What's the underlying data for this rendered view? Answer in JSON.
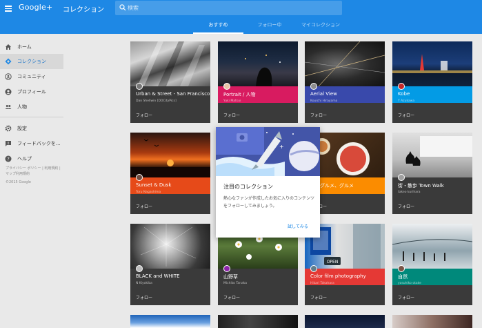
{
  "appbar": {
    "logo": "Google+",
    "title": "コレクション",
    "search_placeholder": "検索",
    "tabs": [
      {
        "label": "おすすめ",
        "active": true
      },
      {
        "label": "フォロー中",
        "active": false
      },
      {
        "label": "マイコレクション",
        "active": false
      }
    ],
    "color": "#1e88e5"
  },
  "sidebar": {
    "items": [
      {
        "label": "ホーム",
        "icon": "home-icon"
      },
      {
        "label": "コレクション",
        "icon": "collections-icon",
        "active": true
      },
      {
        "label": "コミュニティ",
        "icon": "communities-icon"
      },
      {
        "label": "プロフィール",
        "icon": "profile-icon"
      },
      {
        "label": "人物",
        "icon": "people-icon"
      }
    ],
    "secondary": [
      {
        "label": "設定",
        "icon": "gear-icon"
      },
      {
        "label": "フィードバックを...",
        "icon": "feedback-icon"
      },
      {
        "label": "ヘルプ",
        "icon": "help-icon"
      }
    ],
    "footer": {
      "line1": "プライバシー ポリシー | 利用規約 |",
      "line2": "マップ利用規約",
      "line3": "©2015 Google"
    }
  },
  "cards": [
    {
      "title": "Urban & Street - San Francisco",
      "author": "Dan Shellwin [DOCityPics]",
      "follow": "フォロー",
      "color": "#3a3a3a"
    },
    {
      "title": "Portrait / 人物",
      "author": "Yuki Matsui",
      "follow": "フォロー",
      "color": "#d81b60"
    },
    {
      "title": "Aerial View",
      "author": "Kouichi Hirayama",
      "follow": "フォロー",
      "color": "#3949ab"
    },
    {
      "title": "Kobe",
      "author": "Y Azukawa",
      "follow": "フォロー",
      "color": "#039be5"
    },
    {
      "title": "Sunset & Dusk",
      "author": "Toru Nagashima",
      "follow": "フォロー",
      "color": "#e64a19"
    },
    {
      "title": "メ、グルメ、グルメ",
      "author": "本貴",
      "follow": "フォロー",
      "color": "#fb8c00"
    },
    {
      "title": "街・散歩 Town Walk",
      "author": "takeo kurihara",
      "follow": "フォロー",
      "color": "#3a3a3a"
    },
    {
      "title": "BLACK and WHITE",
      "author": "N Kiyokiba",
      "follow": "フォロー",
      "color": "#3a3a3a"
    },
    {
      "title": "山野草",
      "author": "Michiko Tanaka",
      "follow": "フォロー",
      "color": "#3a3a3a"
    },
    {
      "title": "Color film photography",
      "author": "Hikari Takahara",
      "follow": "フォロー",
      "color": "#e53935"
    },
    {
      "title": "自然",
      "author": "yasuhiko otake",
      "follow": "フォロー",
      "color": "#00897b"
    }
  ],
  "popup": {
    "title": "注目のコレクション",
    "body": "熱心なファンが作成したお気に入りのコンテンツをフォローしてみましょう。",
    "button": "試してみる"
  }
}
